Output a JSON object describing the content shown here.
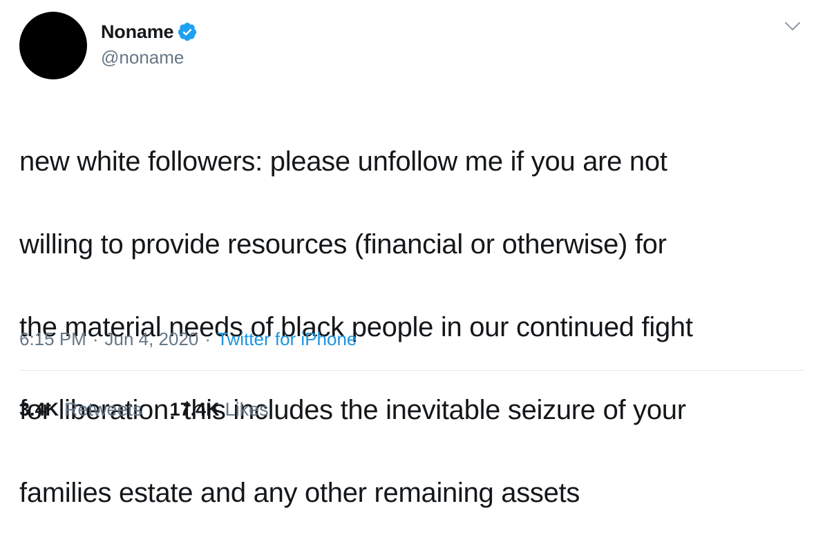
{
  "author": {
    "display_name": "Noname",
    "handle": "@noname",
    "verified_icon": "verified-badge-icon",
    "avatar_color": "#000000"
  },
  "menu": {
    "icon": "chevron-down-icon"
  },
  "tweet": {
    "text_lines": [
      "new white followers: please unfollow me if you are not",
      "willing to provide resources (financial or otherwise) for",
      "the material needs of black people in our continued fight",
      "for liberation. this includes the inevitable seizure of your",
      "families estate and any other remaining assets"
    ]
  },
  "meta": {
    "time": "6:15 PM",
    "separator": "·",
    "date": "Jun 4, 2020",
    "source": "Twitter for iPhone"
  },
  "stats": {
    "retweets_count": "3.4K",
    "retweets_label": "Retweets",
    "likes_count": "17.4K",
    "likes_label": "Likes"
  },
  "colors": {
    "text_primary": "#14171a",
    "text_secondary": "#657786",
    "link": "#1b95e0",
    "verified": "#1da1f2",
    "divider": "#e1e8ed"
  }
}
